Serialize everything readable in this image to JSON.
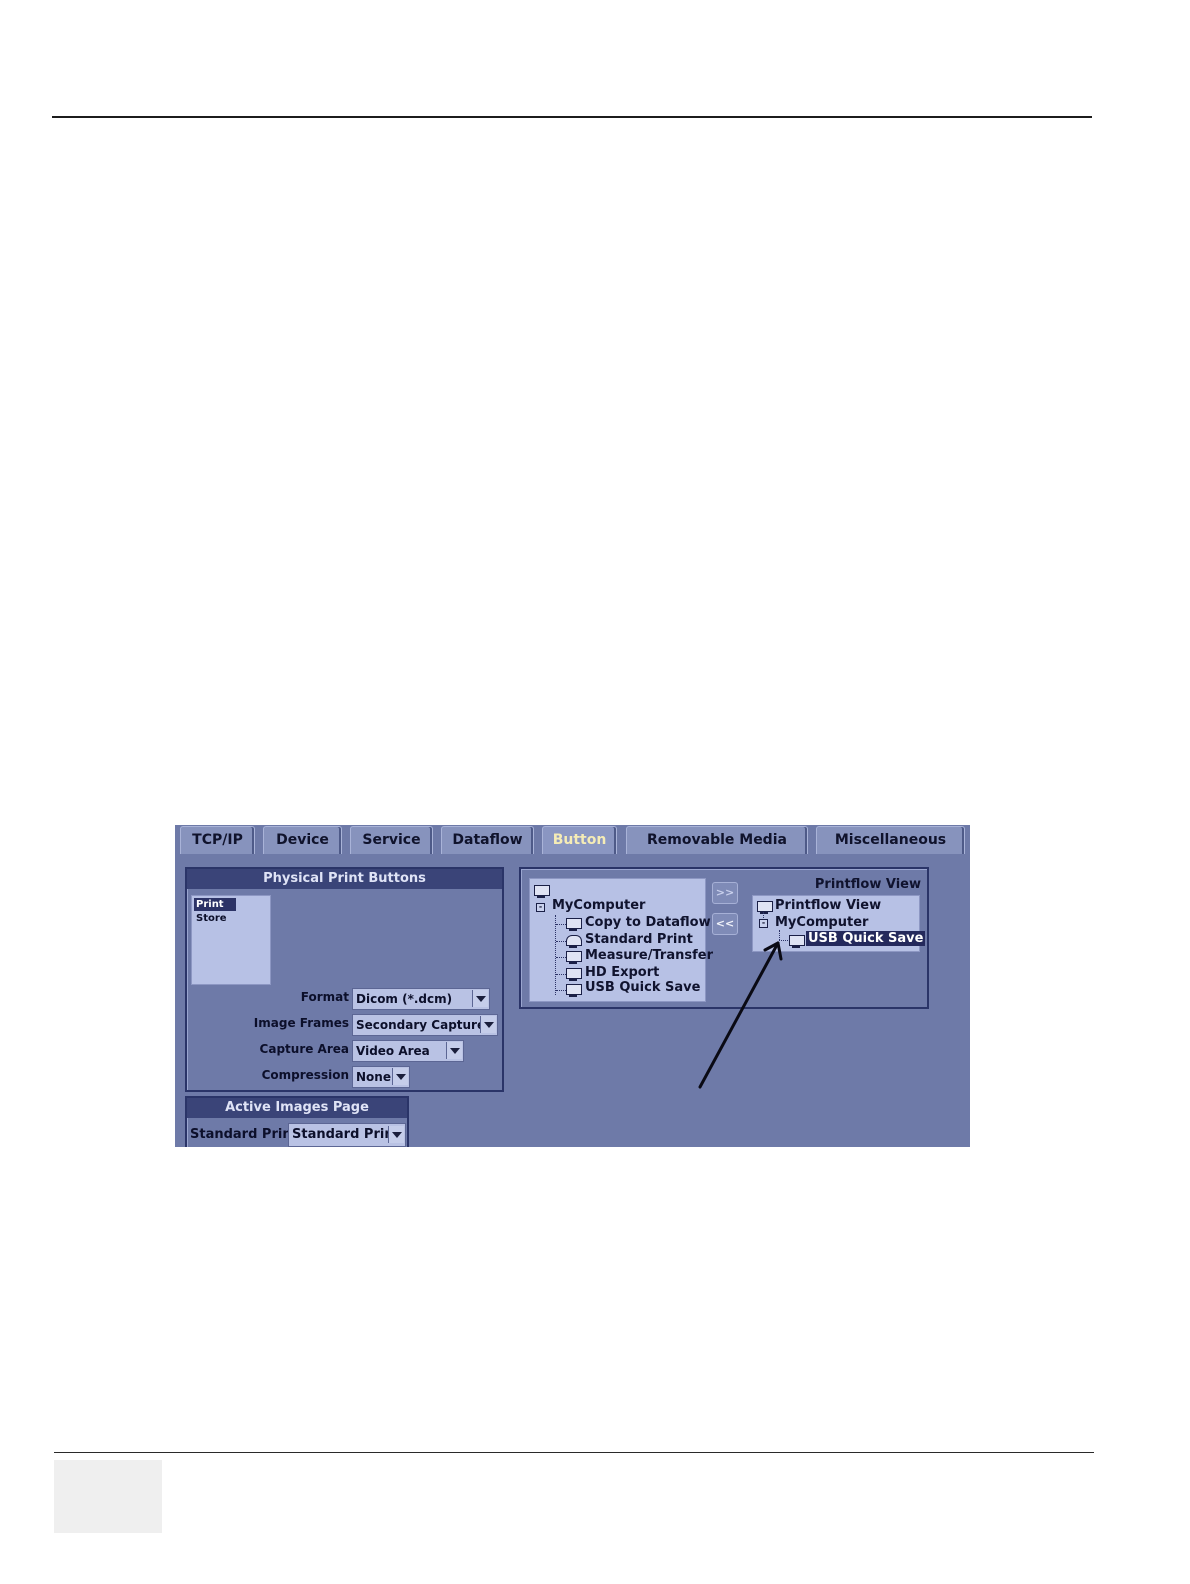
{
  "tabs": [
    "TCP/IP",
    "Device",
    "Service",
    "Dataflow",
    "Button",
    "Removable Media",
    "Miscellaneous"
  ],
  "physical_print": {
    "title": "Physical Print Buttons",
    "items": [
      "Print",
      "Store"
    ]
  },
  "fields": {
    "format": {
      "label": "Format",
      "value": "Dicom (*.dcm)"
    },
    "image_frames": {
      "label": "Image Frames",
      "value": "Secondary Capture"
    },
    "capture_area": {
      "label": "Capture Area",
      "value": "Video Area"
    },
    "compression": {
      "label": "Compression",
      "value": "None"
    }
  },
  "active_images": {
    "title": "Active Images Page",
    "label": "Standard Print",
    "value": "Standard Print"
  },
  "left_tree": {
    "root": "MyComputer",
    "items": [
      "Copy to Dataflow",
      "Standard Print",
      "Measure/Transfer",
      "HD Export",
      "USB Quick Save"
    ]
  },
  "nav": {
    "add": ">>",
    "remove": "<<"
  },
  "printflow": {
    "caption": "Printflow View",
    "root": "Printflow View",
    "computer": "MyComputer",
    "selected": "USB Quick Save"
  },
  "colors": {
    "panel": "#6e7aa8",
    "active_tab_text": "#f5ecb6",
    "selection": "#24295c"
  }
}
